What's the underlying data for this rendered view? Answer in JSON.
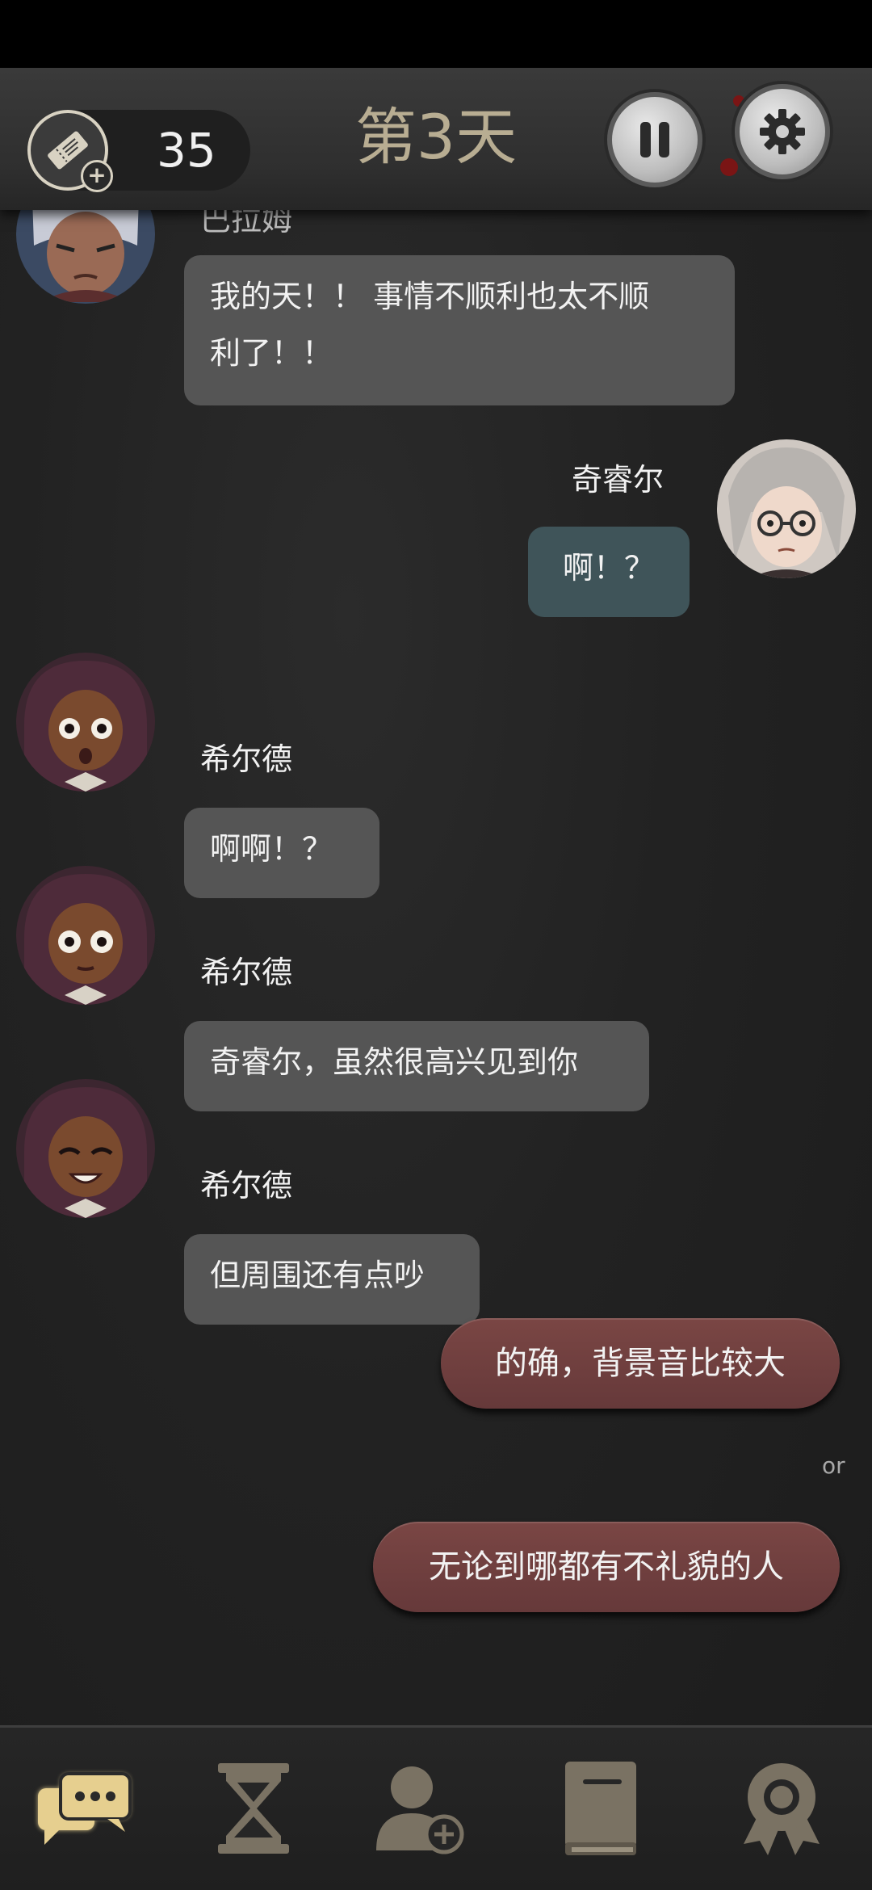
{
  "header": {
    "ticket_count": "35",
    "day_title": "第3天"
  },
  "messages": [
    {
      "side": "left",
      "name": "巴拉姆",
      "text_line1": "我的天！！ 事情不顺利也太不顺",
      "text_line2": "利了！！"
    },
    {
      "side": "right",
      "name": "奇睿尔",
      "text": "啊！？"
    },
    {
      "side": "left",
      "name": "希尔德",
      "text": "啊啊！？"
    },
    {
      "side": "left",
      "name": "希尔德",
      "text": "奇睿尔，虽然很高兴见到你"
    },
    {
      "side": "left",
      "name": "希尔德",
      "text": "但周围还有点吵"
    }
  ],
  "choices": {
    "option1": "的确，背景音比较大",
    "separator": "or",
    "option2": "无论到哪都有不礼貌的人"
  },
  "nav": {
    "items": [
      "chat-icon",
      "hourglass-icon",
      "add-contact-icon",
      "book-icon",
      "badge-icon"
    ],
    "active": "chat-icon"
  },
  "colors": {
    "accent_gold": "#e6cf8f",
    "choice_bubble": "#6f3f3f",
    "player_bubble": "#3f5459",
    "npc_bubble": "#555555"
  }
}
